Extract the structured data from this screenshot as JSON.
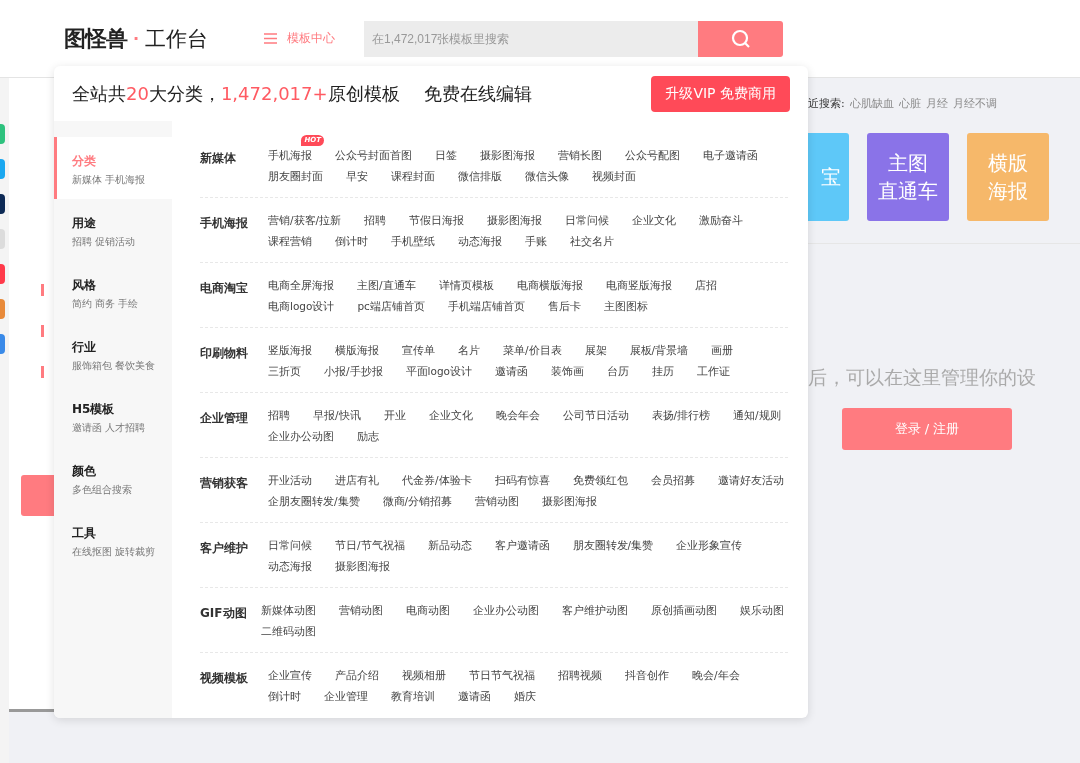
{
  "header": {
    "logo": {
      "brand": "图怪兽",
      "dot": "·",
      "product": "工作台"
    },
    "menu_link": "模板中心",
    "search": {
      "placeholder": "在1,472,017张模板里搜索"
    }
  },
  "background": {
    "recent_search": {
      "label": "近搜索:",
      "terms": [
        "心肌缺血",
        "心脏",
        "月经",
        "月经不调"
      ]
    },
    "cards": [
      {
        "lines": [
          "宝"
        ],
        "color": "#5ec8f8"
      },
      {
        "lines": [
          "主图",
          "直通车"
        ],
        "color": "#8a73e8"
      },
      {
        "lines": [
          "横版",
          "海报"
        ],
        "color": "#f6b86a"
      }
    ],
    "message": "后，可以在这里管理你的设",
    "login_button": "登录 / 注册"
  },
  "dropdown": {
    "headline": [
      {
        "text": "全站共",
        "highlight": false
      },
      {
        "text": "20",
        "highlight": true
      },
      {
        "text": "大分类，",
        "highlight": false
      },
      {
        "text": "1,472,017+",
        "highlight": true
      },
      {
        "text": "原创模板",
        "highlight": false
      }
    ],
    "tagline": "免费在线编辑",
    "vip_button": "升级VIP 免费商用",
    "menu": [
      {
        "title": "分类",
        "subtitle": "新媒体 手机海报",
        "selected": true
      },
      {
        "title": "用途",
        "subtitle": "招聘 促销活动",
        "selected": false
      },
      {
        "title": "风格",
        "subtitle": "简约 商务 手绘",
        "selected": false
      },
      {
        "title": "行业",
        "subtitle": "服饰箱包 餐饮美食",
        "selected": false
      },
      {
        "title": "H5模板",
        "subtitle": "邀请函 人才招聘",
        "selected": false
      },
      {
        "title": "颜色",
        "subtitle": "多色组合搜索",
        "selected": false
      },
      {
        "title": "工具",
        "subtitle": "在线抠图 旋转裁剪",
        "selected": false
      }
    ],
    "sections": [
      {
        "title": "新媒体",
        "links": [
          {
            "text": "手机海报",
            "badge": "HOT"
          },
          {
            "text": "公众号封面首图"
          },
          {
            "text": "日签"
          },
          {
            "text": "摄影图海报"
          },
          {
            "text": "营销长图"
          },
          {
            "text": "公众号配图"
          },
          {
            "text": "电子邀请函"
          },
          {
            "text": "朋友圈封面"
          },
          {
            "text": "早安"
          },
          {
            "text": "课程封面"
          },
          {
            "text": "微信排版"
          },
          {
            "text": "微信头像"
          },
          {
            "text": "视频封面"
          }
        ]
      },
      {
        "title": "手机海报",
        "links": [
          {
            "text": "营销/获客/拉新"
          },
          {
            "text": "招聘"
          },
          {
            "text": "节假日海报"
          },
          {
            "text": "摄影图海报"
          },
          {
            "text": "日常问候"
          },
          {
            "text": "企业文化"
          },
          {
            "text": "激励奋斗"
          },
          {
            "text": "课程营销"
          },
          {
            "text": "倒计时"
          },
          {
            "text": "手机壁纸"
          },
          {
            "text": "动态海报"
          },
          {
            "text": "手账"
          },
          {
            "text": "社交名片"
          }
        ]
      },
      {
        "title": "电商淘宝",
        "links": [
          {
            "text": "电商全屏海报"
          },
          {
            "text": "主图/直通车"
          },
          {
            "text": "详情页模板"
          },
          {
            "text": "电商横版海报"
          },
          {
            "text": "电商竖版海报"
          },
          {
            "text": "店招"
          },
          {
            "text": "电商logo设计"
          },
          {
            "text": "pc端店铺首页"
          },
          {
            "text": "手机端店铺首页"
          },
          {
            "text": "售后卡"
          },
          {
            "text": "主图图标"
          }
        ]
      },
      {
        "title": "印刷物料",
        "links": [
          {
            "text": "竖版海报"
          },
          {
            "text": "横版海报"
          },
          {
            "text": "宣传单"
          },
          {
            "text": "名片"
          },
          {
            "text": "菜单/价目表"
          },
          {
            "text": "展架"
          },
          {
            "text": "展板/背景墙"
          },
          {
            "text": "画册"
          },
          {
            "text": "三折页"
          },
          {
            "text": "小报/手抄报"
          },
          {
            "text": "平面logo设计"
          },
          {
            "text": "邀请函"
          },
          {
            "text": "装饰画"
          },
          {
            "text": "台历"
          },
          {
            "text": "挂历"
          },
          {
            "text": "工作证"
          }
        ]
      },
      {
        "title": "企业管理",
        "links": [
          {
            "text": "招聘"
          },
          {
            "text": "早报/快讯"
          },
          {
            "text": "开业"
          },
          {
            "text": "企业文化"
          },
          {
            "text": "晚会年会"
          },
          {
            "text": "公司节日活动"
          },
          {
            "text": "表扬/排行榜"
          },
          {
            "text": "通知/规则"
          },
          {
            "text": "企业办公动图"
          },
          {
            "text": "励志"
          }
        ]
      },
      {
        "title": "营销获客",
        "links": [
          {
            "text": "开业活动"
          },
          {
            "text": "进店有礼"
          },
          {
            "text": "代金券/体验卡"
          },
          {
            "text": "扫码有惊喜"
          },
          {
            "text": "免费领红包"
          },
          {
            "text": "会员招募"
          },
          {
            "text": "邀请好友活动"
          },
          {
            "text": "企朋友圈转发/集赞"
          },
          {
            "text": "微商/分销招募"
          },
          {
            "text": "营销动图"
          },
          {
            "text": "摄影图海报"
          }
        ]
      },
      {
        "title": "客户维护",
        "links": [
          {
            "text": "日常问候"
          },
          {
            "text": "节日/节气祝福"
          },
          {
            "text": "新品动态"
          },
          {
            "text": "客户邀请函"
          },
          {
            "text": "朋友圈转发/集赞"
          },
          {
            "text": "企业形象宣传"
          },
          {
            "text": "动态海报"
          },
          {
            "text": "摄影图海报"
          }
        ]
      },
      {
        "title": "GIF动图",
        "links": [
          {
            "text": "新媒体动图"
          },
          {
            "text": "营销动图"
          },
          {
            "text": "电商动图"
          },
          {
            "text": "企业办公动图"
          },
          {
            "text": "客户维护动图"
          },
          {
            "text": "原创插画动图"
          },
          {
            "text": "娱乐动图"
          },
          {
            "text": "二维码动图"
          }
        ]
      },
      {
        "title": "视频模板",
        "links": [
          {
            "text": "企业宣传"
          },
          {
            "text": "产品介绍"
          },
          {
            "text": "视频相册"
          },
          {
            "text": "节日节气祝福"
          },
          {
            "text": "招聘视频"
          },
          {
            "text": "抖音创作"
          },
          {
            "text": "晚会/年会"
          },
          {
            "text": "倒计时"
          },
          {
            "text": "企业管理"
          },
          {
            "text": "教育培训"
          },
          {
            "text": "邀请函"
          },
          {
            "text": "婚庆"
          }
        ]
      }
    ]
  }
}
